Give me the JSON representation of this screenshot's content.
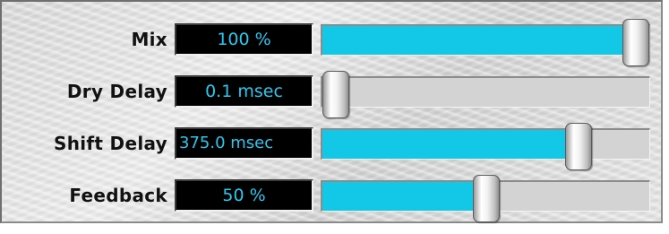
{
  "colors": {
    "fill": "#12c8e6",
    "readout_text": "#28c8ee",
    "readout_bg": "#000000",
    "track": "#d3d3d3"
  },
  "controls": [
    {
      "label": "Mix",
      "readout": "100 %",
      "level": 1.0
    },
    {
      "label": "Dry Delay",
      "readout": "0.1 msec",
      "level": 0.0
    },
    {
      "label": "Shift Delay",
      "readout": "375.0 msec",
      "level": 0.81
    },
    {
      "label": "Feedback",
      "readout": "50 %",
      "level": 0.5
    }
  ]
}
